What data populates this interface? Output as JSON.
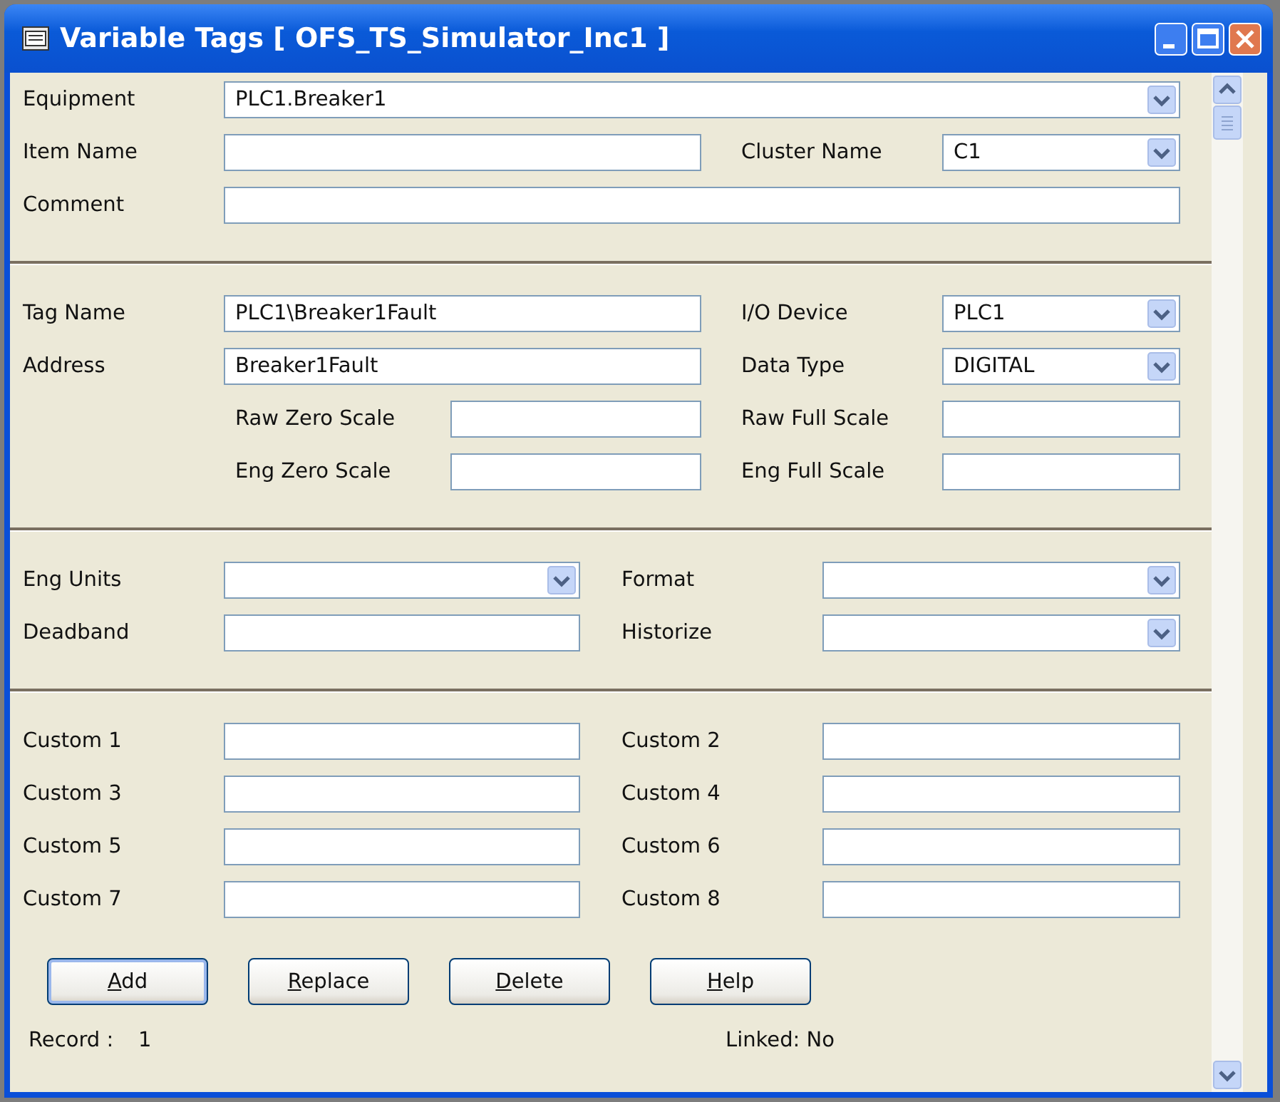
{
  "window": {
    "title": "Variable Tags [ OFS_TS_Simulator_Inc1 ]"
  },
  "sections": [
    {
      "kind": "wide",
      "rows": [
        {
          "kind": "plain",
          "fields": [
            {
              "label": "Equipment",
              "kind": "combo",
              "value": "PLC1.Breaker1"
            }
          ]
        },
        {
          "kind": "plain",
          "fields": [
            {
              "label": "Item Name",
              "kind": "text"
            },
            {
              "label": "Cluster Name",
              "kind": "combo",
              "value": "C1"
            }
          ]
        },
        {
          "kind": "plain",
          "fields": [
            {
              "label": "Comment",
              "kind": "text"
            }
          ]
        }
      ]
    },
    {
      "kind": "wide",
      "rows": [
        {
          "kind": "plain",
          "fields": [
            {
              "label": "Tag Name",
              "kind": "text",
              "value": "PLC1\\Breaker1Fault"
            },
            {
              "label": "I/O Device",
              "kind": "combo",
              "value": "PLC1"
            }
          ]
        },
        {
          "kind": "plain",
          "fields": [
            {
              "label": "Address",
              "kind": "text",
              "value": "Breaker1Fault"
            },
            {
              "label": "Data Type",
              "kind": "combo",
              "value": "DIGITAL"
            }
          ]
        },
        {
          "kind": "indented",
          "fields": [
            {
              "label": "Raw Zero Scale",
              "kind": "text"
            },
            {
              "label": "Raw Full Scale",
              "kind": "text"
            }
          ]
        },
        {
          "kind": "indented",
          "fields": [
            {
              "label": "Eng Zero Scale",
              "kind": "text"
            },
            {
              "label": "Eng Full Scale",
              "kind": "text"
            }
          ]
        }
      ]
    },
    {
      "kind": "half",
      "rows": [
        {
          "kind": "plain",
          "fields": [
            {
              "label": "Eng Units",
              "kind": "combo"
            },
            {
              "label": "Format",
              "kind": "combo"
            }
          ]
        },
        {
          "kind": "plain",
          "fields": [
            {
              "label": "Deadband",
              "kind": "text"
            },
            {
              "label": "Historize",
              "kind": "combo"
            }
          ]
        }
      ]
    },
    {
      "kind": "half",
      "rows": [
        {
          "kind": "plain",
          "fields": [
            {
              "label": "Custom 1",
              "kind": "text"
            },
            {
              "label": "Custom 2",
              "kind": "text"
            }
          ]
        },
        {
          "kind": "plain",
          "fields": [
            {
              "label": "Custom 3",
              "kind": "text"
            },
            {
              "label": "Custom 4",
              "kind": "text"
            }
          ]
        },
        {
          "kind": "plain",
          "fields": [
            {
              "label": "Custom 5",
              "kind": "text"
            },
            {
              "label": "Custom 6",
              "kind": "text"
            }
          ]
        },
        {
          "kind": "plain",
          "fields": [
            {
              "label": "Custom 7",
              "kind": "text"
            },
            {
              "label": "Custom 8",
              "kind": "text"
            }
          ]
        }
      ]
    }
  ],
  "buttons": [
    {
      "label": "Add",
      "underline_first": true,
      "default": true
    },
    {
      "label": "Replace",
      "underline_first": true,
      "default": false
    },
    {
      "label": "Delete",
      "underline_first": true,
      "default": false
    },
    {
      "label": "Help",
      "underline_first": true,
      "default": false
    }
  ],
  "status": {
    "record_label": "Record :",
    "record_value": "1",
    "linked": "Linked: No"
  }
}
